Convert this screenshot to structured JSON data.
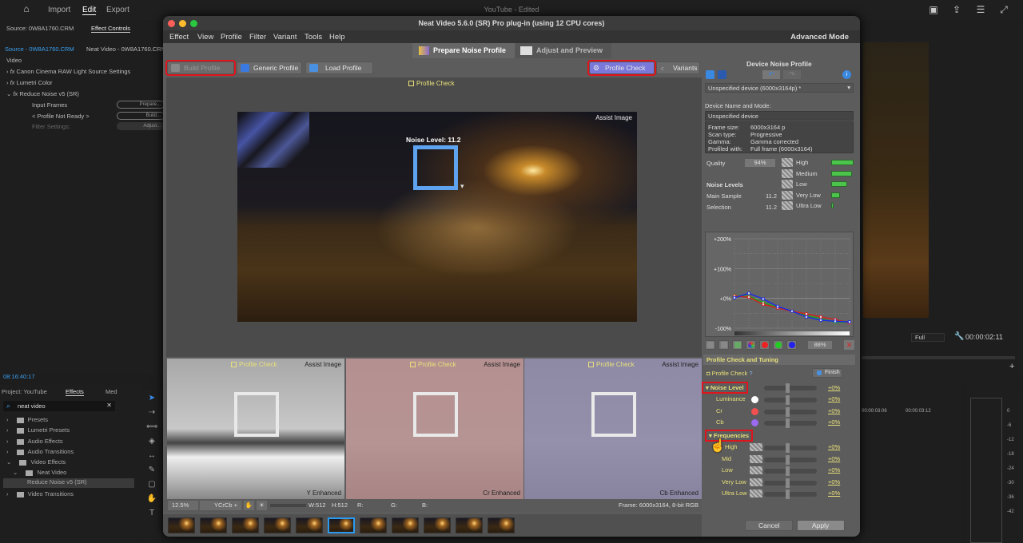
{
  "premiere": {
    "nav": [
      "Import",
      "Edit",
      "Export"
    ],
    "title": "YouTube - Edited",
    "source_tab": "Source: 0W8A1760.CRM",
    "effect_controls_tab": "Effect Controls",
    "clip_source": "Source - 0W8A1760.CRM",
    "clip_seq": "Neat Video - 0W8A1760.CRM",
    "video_label": "Video",
    "effects": [
      "Canon Cinema RAW Light Source Settings",
      "Lumetri Color",
      "Reduce Noise v5 (SR)"
    ],
    "params": [
      {
        "label": "Input Frames",
        "button": "Prepare..."
      },
      {
        "label": "< Profile Not Ready >",
        "button": "Build..."
      },
      {
        "label": "Filter Settings:",
        "button": "Adjust..."
      }
    ],
    "timecode": "08:16:40:17",
    "project_tab": "Project: YouTube",
    "effects_tab": "Effects",
    "media_tab": "Med",
    "search_value": "neat video",
    "tree": [
      "Presets",
      "Lumetri Presets",
      "Audio Effects",
      "Audio Transitions",
      "Video Effects",
      "Neat Video",
      "Reduce Noise v5 (SR)",
      "Video Transitions"
    ],
    "program_quality": "Full",
    "program_time": "00:00:02:11",
    "ruler": [
      "00:00:03:06",
      "00:00:03:12"
    ],
    "meter": [
      "0",
      "-6",
      "-12",
      "-18",
      "-24",
      "-30",
      "-36",
      "-42"
    ]
  },
  "plugin": {
    "title": "Neat Video 5.6.0 (SR) Pro plug-in (using 12 CPU cores)",
    "menu": [
      "Effect",
      "View",
      "Profile",
      "Filter",
      "Variant",
      "Tools",
      "Help"
    ],
    "mode": "Advanced Mode",
    "tabs": [
      "Prepare Noise Profile",
      "Adjust and Preview"
    ],
    "toolbar": {
      "build": "Build Profile",
      "generic": "Generic Profile",
      "load": "Load Profile",
      "check": "Profile Check",
      "variants": "Variants"
    },
    "profile_check_label": "Profile Check",
    "assist_image": "Assist Image",
    "noise_level_overlay": "Noise Level: 11.2",
    "panes": [
      "Y Enhanced",
      "Cr Enhanced",
      "Cb Enhanced"
    ],
    "status": {
      "zoom": "12.5%",
      "channel": "YCrCb +",
      "w": "W:512",
      "h": "H:512",
      "r": "R:",
      "g": "G:",
      "b": "B:",
      "frame": "Frame: 6000x3164, 8-bit RGB"
    },
    "thumb_count": 11,
    "selected_thumb": 5,
    "cancel": "Cancel",
    "apply": "Apply"
  },
  "profile_panel": {
    "title": "Device Noise Profile",
    "device_select": "Unspecified device (6000x3164p) *",
    "name_mode_label": "Device Name and Mode:",
    "device_name": "Unspecified device",
    "info": [
      [
        "Frame size:",
        "6000x3164 p"
      ],
      [
        "Scan type:",
        "Progressive"
      ],
      [
        "Gamma:",
        "Gamma corrected"
      ],
      [
        "Profiled with:",
        "Full frame (6000x3164)"
      ]
    ],
    "quality_label": "Quality",
    "quality": "94%",
    "noise_levels_label": "Noise Levels",
    "main_sample_label": "Main Sample",
    "main_sample": "11.2",
    "selection_label": "Selection",
    "selection": "11.2",
    "freq_bars": [
      {
        "label": "High",
        "value": 100
      },
      {
        "label": "Medium",
        "value": 92
      },
      {
        "label": "Low",
        "value": 70
      },
      {
        "label": "Very Low",
        "value": 38
      },
      {
        "label": "Ultra Low",
        "value": 12
      }
    ],
    "zoom_pct": "88%"
  },
  "chart_data": {
    "type": "line",
    "y_ticks": [
      "+200%",
      "+100%",
      "+0%",
      "-100%"
    ],
    "ylim": [
      -100,
      200
    ],
    "x": [
      1,
      2,
      3,
      4,
      5,
      6,
      7,
      8,
      9
    ],
    "series": [
      {
        "name": "Luminance",
        "color": "#1a2ee0",
        "values": [
          2,
          17,
          -2,
          -27,
          -43,
          -62,
          -73,
          -77,
          -79
        ]
      },
      {
        "name": "Cr",
        "color": "#d42020",
        "values": [
          8,
          4,
          -20,
          -32,
          -43,
          -52,
          -62,
          -71,
          -82
        ]
      },
      {
        "name": "Cb",
        "color": "#1ea01e",
        "values": [
          9,
          7,
          -14,
          -30,
          -43,
          -57,
          -68,
          -80,
          -80
        ]
      }
    ]
  },
  "tuning": {
    "title": "Profile Check and Tuning",
    "profile_check": "Profile Check",
    "finish": "Finish",
    "noise_level": "Noise Level",
    "noise_level_value": "+0%",
    "channels": [
      {
        "label": "Luminance",
        "color": "#ffffff",
        "value": "+0%"
      },
      {
        "label": "Cr",
        "color": "#f05050",
        "value": "+0%"
      },
      {
        "label": "Cb",
        "color": "#9a6af0",
        "value": "+0%"
      }
    ],
    "frequencies": "Frequencies",
    "freqs": [
      {
        "label": "High",
        "value": "+0%"
      },
      {
        "label": "Mid",
        "value": "+0%"
      },
      {
        "label": "Low",
        "value": "+0%"
      },
      {
        "label": "Very Low",
        "value": "+0%"
      },
      {
        "label": "Ultra Low",
        "value": "+0%"
      }
    ]
  }
}
